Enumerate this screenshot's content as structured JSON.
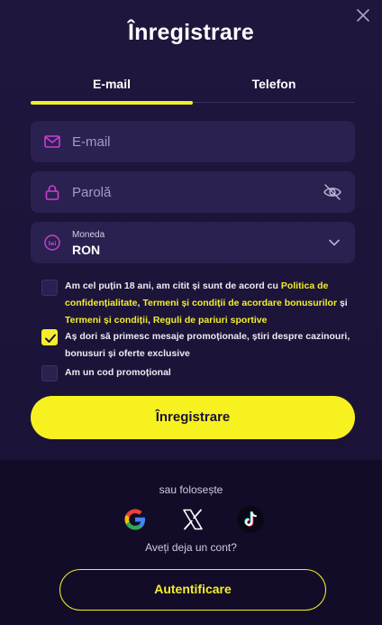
{
  "title": "Înregistrare",
  "tabs": [
    {
      "label": "E-mail",
      "active": true
    },
    {
      "label": "Telefon",
      "active": false
    }
  ],
  "form": {
    "email_placeholder": "E-mail",
    "password_placeholder": "Parolă",
    "currency_label": "Moneda",
    "currency_value": "RON"
  },
  "terms": {
    "text_before": "Am cel puțin 18 ani, am citit și sunt de acord cu ",
    "link1": "Politica de confidențialitate",
    "sep1": ", ",
    "link2": "Termeni și condiții de acordare bonusurilor",
    "sep2": " și ",
    "link3": "Termeni și condiții",
    "sep3": ", ",
    "link4": "Reguli de pariuri sportive",
    "checked": false
  },
  "promo_messages": {
    "text": "Aș dori să primesc mesaje promoționale, știri despre cazinouri, bonusuri și oferte exclusive",
    "checked": true
  },
  "promo_code": {
    "text": "Am un cod promoțional",
    "checked": false
  },
  "submit_label": "Înregistrare",
  "social_label": "sau folosește",
  "social": [
    "google-icon",
    "x-icon",
    "tiktok-icon"
  ],
  "account_prompt": "Aveți deja un cont?",
  "login_label": "Autentificare",
  "colors": {
    "accent": "#f3ee2c",
    "background": "#1f163d",
    "field": "#2a2150",
    "icon": "#c93fd0"
  }
}
